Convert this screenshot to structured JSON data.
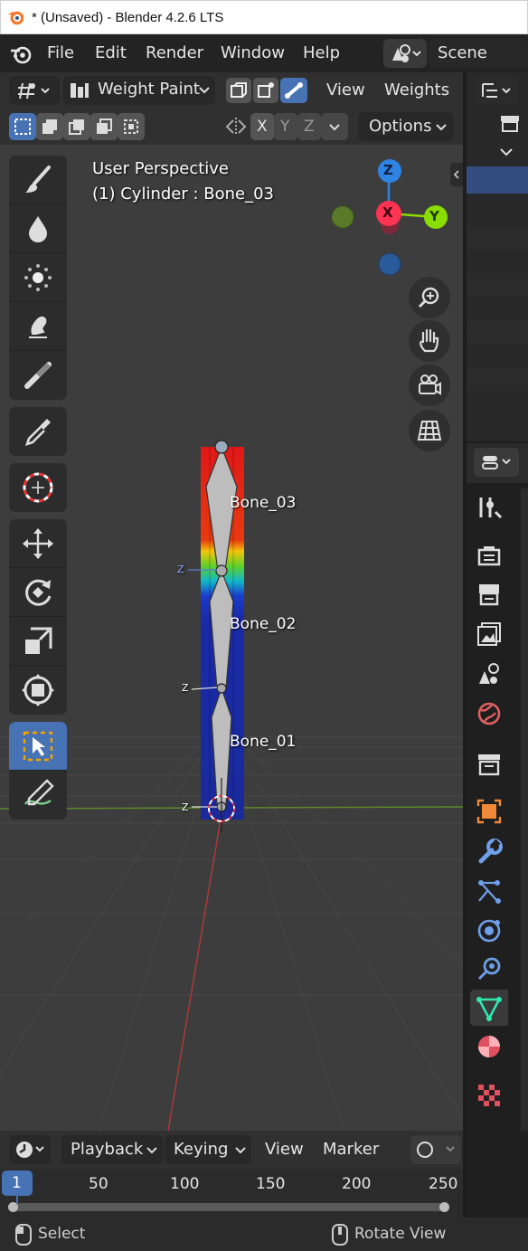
{
  "window": {
    "title": "* (Unsaved) - Blender 4.2.6 LTS"
  },
  "menu": {
    "file": "File",
    "edit": "Edit",
    "render": "Render",
    "window": "Window",
    "help": "Help",
    "scene": "Scene"
  },
  "header": {
    "mode": "Weight Paint",
    "view": "View",
    "weights": "Weights",
    "axis_x": "X",
    "axis_y": "Y",
    "axis_z": "Z",
    "options": "Options"
  },
  "viewport": {
    "perspective": "User Perspective",
    "object_info": "(1) Cylinder : Bone_03",
    "gizmo": {
      "z": "Z",
      "x": "X",
      "y": "Y"
    },
    "bones": [
      {
        "name": "Bone_03"
      },
      {
        "name": "Bone_02"
      },
      {
        "name": "Bone_01"
      }
    ],
    "bone_axis_label": "Z"
  },
  "timeline": {
    "playback": "Playback",
    "keying": "Keying",
    "view": "View",
    "marker": "Marker",
    "current_frame": "1",
    "ticks": [
      "50",
      "100",
      "150",
      "200",
      "250"
    ]
  },
  "status": {
    "select": "Select",
    "rotate": "Rotate View"
  },
  "colors": {
    "accent": "#4772b3",
    "viewport_bg": "#3d3d3d",
    "axis_x": "#ff3352",
    "axis_y": "#8bdc00",
    "axis_z": "#2f83e3"
  }
}
